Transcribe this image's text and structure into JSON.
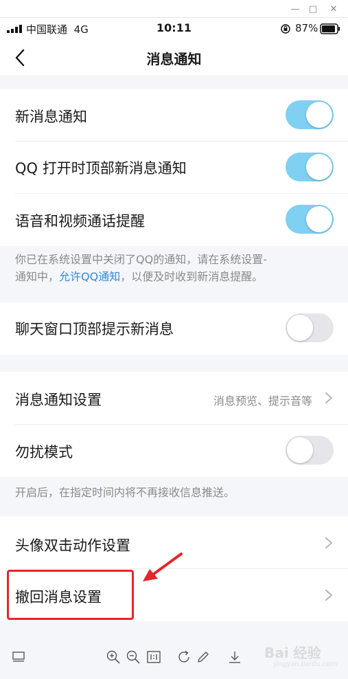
{
  "status_bar": {
    "carrier": "中国联通",
    "network": "4G",
    "time": "10:11",
    "battery": "87%"
  },
  "nav": {
    "title": "消息通知"
  },
  "rows": [
    {
      "label": "新消息通知",
      "toggle": "on"
    },
    {
      "label": "QQ 打开时顶部新消息通知",
      "toggle": "on"
    },
    {
      "label": "语音和视频通话提醒",
      "toggle": "on"
    }
  ],
  "system_note": {
    "line1": "你已在系统设置中关闭了QQ的通知，请在系统设置-",
    "line2_prefix": "通知中，",
    "link": "允许QQ通知",
    "line2_suffix": "，以便及时收到新消息提醒。"
  },
  "chat_top_row": {
    "label": "聊天窗口顶部提示新消息",
    "toggle": "off"
  },
  "notify_settings": {
    "label": "消息通知设置",
    "detail": "消息预览、提示音等"
  },
  "dnd": {
    "label": "勿扰模式",
    "toggle": "off"
  },
  "dnd_note": "开启后，在指定时间内将不再接收信息推送。",
  "avatar_row": {
    "label": "头像双击动作设置"
  },
  "recall_row": {
    "label": "撤回消息设置"
  },
  "watermark": {
    "text": "Bai 经验",
    "sub": "jingyan.baidu.com"
  },
  "colors": {
    "toggle_on": "#7fd0f2",
    "toggle_off": "#e5e5ea",
    "link": "#2f8ad9",
    "highlight": "#e5252a"
  }
}
